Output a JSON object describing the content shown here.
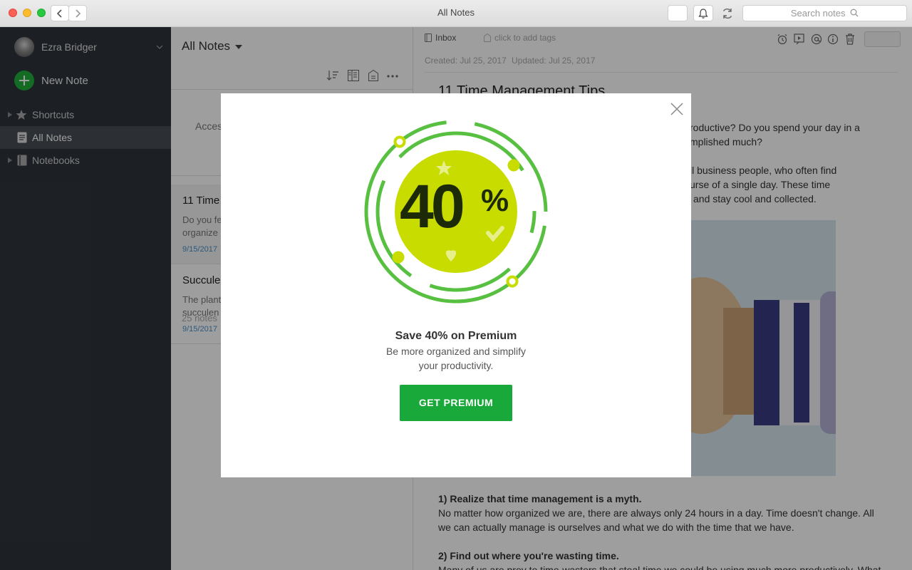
{
  "window": {
    "title": "All Notes"
  },
  "search": {
    "placeholder": "Search notes"
  },
  "sidebar": {
    "user_name": "Ezra Bridger",
    "new_note": "New Note",
    "items": [
      {
        "label": "Shortcuts"
      },
      {
        "label": "All Notes"
      },
      {
        "label": "Notebooks"
      }
    ]
  },
  "notelist": {
    "title": "All Notes",
    "partial_text": "Acces",
    "count": "25 notes",
    "notes": [
      {
        "title": "11 Time",
        "line1": "Do you fe",
        "line2": "organize",
        "date": "9/15/2017"
      },
      {
        "title": "Succulen",
        "line1": "The plant",
        "line2": "succulen",
        "date": "9/15/2017"
      }
    ]
  },
  "editor": {
    "notebook": "Inbox",
    "tags_placeholder": "click to add tags",
    "created": "Created: Jul 25, 2017",
    "updated": "Updated: Jul 25, 2017",
    "title": "11 Time Management Tips",
    "p1_line1": "roductive? Do you spend your day in a",
    "p1_line2": "mplished much?",
    "p2_line1": "ll business people, who often find",
    "p2_line2": "urse of a single day. These time",
    "p2_line3": "and stay cool and collected.",
    "h1": "1) Realize that time management is a myth.",
    "h1_line1": "No matter how organized we are, there are always only 24 hours in a day. Time doesn't change. All",
    "h1_line2": "we can actually manage is ourselves and what we do with the time that we have.",
    "h2": "2) Find out where you're wasting time.",
    "h2_line1": "Many of us are prey to time-wasters that steal time we could be using much more productively. What"
  },
  "modal": {
    "badge_number": "40",
    "badge_percent": "%",
    "headline": "Save 40% on Premium",
    "sub1": "Be more organized and simplify",
    "sub2": "your productivity.",
    "cta": "GET PREMIUM"
  },
  "colors": {
    "accent": "#19a83a",
    "badge_lime": "#c8dc00",
    "badge_ring": "#58c040",
    "sidebar_bg": "#2e343a"
  }
}
